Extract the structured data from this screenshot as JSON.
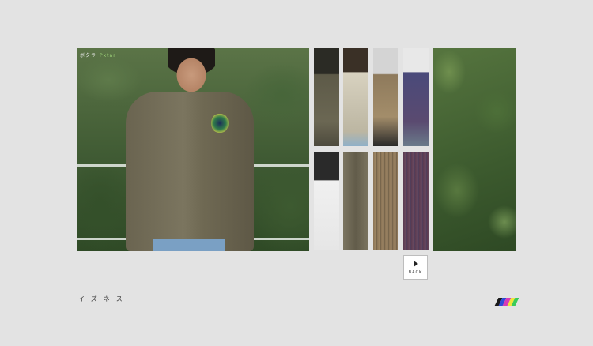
{
  "main_photo": {
    "label": "ボタラ",
    "tag": "Pxtar"
  },
  "thumbnails": [
    {
      "name": "thumb-1",
      "caption": ""
    },
    {
      "name": "thumb-2",
      "caption": ""
    },
    {
      "name": "thumb-3",
      "caption": ""
    },
    {
      "name": "thumb-4",
      "caption": ""
    },
    {
      "name": "thumb-5",
      "caption": ""
    },
    {
      "name": "thumb-6",
      "caption": ""
    },
    {
      "name": "thumb-7",
      "caption": ""
    },
    {
      "name": "thumb-8",
      "caption": ""
    }
  ],
  "back_button": {
    "label": "BACK",
    "icon": "play-arrow-icon"
  },
  "site_title": "イズネス",
  "color_bars": [
    "#1a1a1a",
    "#2f49d8",
    "#d63ab7",
    "#f0e43a",
    "#3acb5a"
  ],
  "colors": {
    "background": "#e3e3e3"
  }
}
